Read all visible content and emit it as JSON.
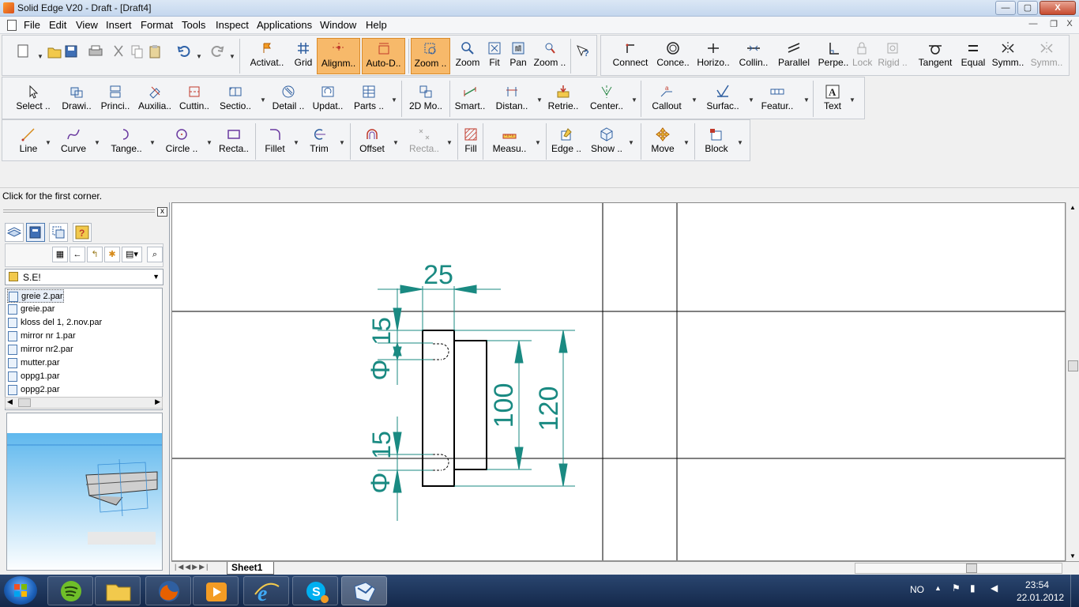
{
  "window": {
    "title": "Solid Edge V20 - Draft - [Draft4]",
    "min_label": "—",
    "max_label": "▢",
    "close_label": "X"
  },
  "menu": {
    "items": [
      "File",
      "Edit",
      "View",
      "Insert",
      "Format",
      "Tools",
      "Inspect",
      "Applications",
      "Window",
      "Help"
    ],
    "mdi_min": "—",
    "mdi_restore": "❐",
    "mdi_close": "X"
  },
  "toolbar1": {
    "left_buttons": [
      {
        "label": "Activat..",
        "icon": "activate-icon"
      },
      {
        "label": "Grid",
        "icon": "grid-icon"
      },
      {
        "label": "Alignm..",
        "icon": "alignment-icon",
        "highlighted": true
      },
      {
        "label": "Auto-D..",
        "icon": "auto-dimension-icon",
        "highlighted": true
      },
      {
        "label": "Zoom ..",
        "icon": "zoom-area-icon",
        "highlighted": true
      },
      {
        "label": "Zoom",
        "icon": "zoom-icon"
      },
      {
        "label": "Fit",
        "icon": "fit-icon"
      },
      {
        "label": "Pan",
        "icon": "pan-icon"
      },
      {
        "label": "Zoom ..",
        "icon": "zoom-dynamic-icon"
      }
    ],
    "relations": [
      {
        "label": "Connect",
        "icon": "connect-icon"
      },
      {
        "label": "Conce..",
        "icon": "concentric-icon"
      },
      {
        "label": "Horizo..",
        "icon": "horizontal-icon"
      },
      {
        "label": "Collin..",
        "icon": "collinear-icon"
      },
      {
        "label": "Parallel",
        "icon": "parallel-icon"
      },
      {
        "label": "Perpe..",
        "icon": "perpendicular-icon"
      },
      {
        "label": "Lock",
        "icon": "lock-icon",
        "disabled": true
      },
      {
        "label": "Rigid ..",
        "icon": "rigid-icon",
        "disabled": true
      },
      {
        "label": "Tangent",
        "icon": "tangent-icon"
      },
      {
        "label": "Equal",
        "icon": "equal-icon"
      },
      {
        "label": "Symm..",
        "icon": "symmetric-icon"
      },
      {
        "label": "Symm..",
        "icon": "symmetric-axis-icon",
        "disabled": true
      }
    ]
  },
  "toolbar2": {
    "buttons": [
      {
        "label": "Select ..",
        "icon": "select-icon"
      },
      {
        "label": "Drawi..",
        "icon": "drawing-view-icon"
      },
      {
        "label": "Princi..",
        "icon": "principal-view-icon"
      },
      {
        "label": "Auxilia..",
        "icon": "auxiliary-view-icon"
      },
      {
        "label": "Cuttin..",
        "icon": "cutting-plane-icon"
      },
      {
        "label": "Sectio..",
        "icon": "section-view-icon"
      },
      {
        "label": "Detail ..",
        "icon": "detail-view-icon"
      },
      {
        "label": "Updat..",
        "icon": "update-views-icon"
      },
      {
        "label": "Parts ..",
        "icon": "parts-list-icon"
      },
      {
        "label": "2D Mo..",
        "icon": "2d-model-icon"
      },
      {
        "label": "Smart..",
        "icon": "smart-dimension-icon"
      },
      {
        "label": "Distan..",
        "icon": "distance-icon"
      },
      {
        "label": "Retrie..",
        "icon": "retrieve-icon"
      },
      {
        "label": "Center..",
        "icon": "center-line-icon"
      },
      {
        "label": "Callout",
        "icon": "callout-icon"
      },
      {
        "label": "Surfac..",
        "icon": "surface-texture-icon"
      },
      {
        "label": "Featur..",
        "icon": "feature-control-icon"
      },
      {
        "label": "Text",
        "icon": "text-icon"
      }
    ]
  },
  "toolbar3": {
    "buttons": [
      {
        "label": "Line",
        "icon": "line-icon"
      },
      {
        "label": "Curve",
        "icon": "curve-icon"
      },
      {
        "label": "Tange..",
        "icon": "tangent-arc-icon"
      },
      {
        "label": "Circle ..",
        "icon": "circle-icon"
      },
      {
        "label": "Recta..",
        "icon": "rectangle-icon"
      },
      {
        "label": "Fillet",
        "icon": "fillet-icon"
      },
      {
        "label": "Trim",
        "icon": "trim-icon"
      },
      {
        "label": "Offset",
        "icon": "offset-icon"
      },
      {
        "label": "Recta..",
        "icon": "rectangular-pattern-icon",
        "disabled": true
      },
      {
        "label": "Fill",
        "icon": "fill-icon"
      },
      {
        "label": "Measu..",
        "icon": "measure-icon"
      },
      {
        "label": "Edge ..",
        "icon": "edge-painter-icon"
      },
      {
        "label": "Show ..",
        "icon": "show-hide-icon"
      },
      {
        "label": "Move",
        "icon": "move-icon"
      },
      {
        "label": "Block",
        "icon": "block-icon"
      }
    ]
  },
  "status": {
    "prompt": "Click for the first corner."
  },
  "library": {
    "folder": "S.E!",
    "files": [
      "greie 2.par",
      "greie.par",
      "kloss del 1, 2.nov.par",
      "mirror nr 1.par",
      "mirror nr2.par",
      "mutter.par",
      "oppg1.par",
      "oppg2.par"
    ],
    "close_label": "x"
  },
  "drawing": {
    "dimensions": {
      "width_top": "25",
      "dist_top": "15",
      "dist_bottom": "15",
      "height_inner": "100",
      "height_outer": "120",
      "diameter_symbol": "Φ"
    },
    "colors": {
      "dimension": "#1a8a82",
      "geometry": "#000000"
    }
  },
  "sheets": {
    "active": "Sheet1"
  },
  "taskbar": {
    "language": "NO",
    "time": "23:54",
    "date": "22.01.2012",
    "apps": [
      "spotify",
      "explorer",
      "firefox",
      "media-player",
      "internet-explorer",
      "skype",
      "solid-edge"
    ]
  }
}
